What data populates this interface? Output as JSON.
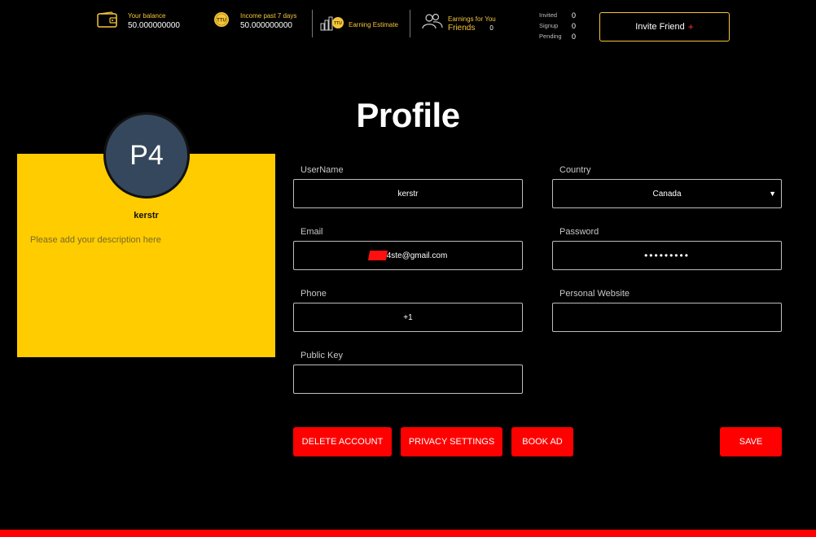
{
  "topbar": {
    "balance": {
      "label": "Your balance",
      "value": "50.000000000",
      "icon": "wallet-icon"
    },
    "income": {
      "label": "Income past 7 days",
      "value": "50.000000000",
      "icon": "ttu-coin-icon",
      "coin_text": "TTU"
    },
    "estimate": {
      "label": "Earning Estimate",
      "icon": "bar-chart-coin-icon",
      "coin_text": "TTU"
    },
    "friends": {
      "label": "Earnings for You",
      "label2": "Friends",
      "value": "0",
      "icon": "users-icon"
    },
    "invites": [
      {
        "label": "Invited",
        "value": "0"
      },
      {
        "label": "Signup",
        "value": "0"
      },
      {
        "label": "Pending",
        "value": "0"
      }
    ],
    "invite_button": {
      "label": "Invite Friend",
      "plus": "+"
    }
  },
  "page": {
    "title": "Profile"
  },
  "card": {
    "avatar_initials": "P4",
    "name": "kerstr",
    "description_placeholder": "Please add your description here",
    "bg_color": "#ffcc00"
  },
  "form": {
    "username": {
      "label": "UserName",
      "value": "kerstr"
    },
    "country": {
      "label": "Country",
      "value": "Canada"
    },
    "email": {
      "label": "Email",
      "value": "4ste@gmail.com"
    },
    "password": {
      "label": "Password",
      "value": "•••••••••"
    },
    "phone": {
      "label": "Phone",
      "value": "+1"
    },
    "website": {
      "label": "Personal Website",
      "value": ""
    },
    "public_key": {
      "label": "Public Key",
      "value": ""
    }
  },
  "actions": {
    "delete": "DELETE ACCOUNT",
    "privacy": "PRIVACY SETTINGS",
    "book_ad": "BOOK AD",
    "save": "SAVE"
  },
  "colors": {
    "accent": "#ff0000",
    "gold": "#f4c53a",
    "avatar": "#34475c"
  }
}
